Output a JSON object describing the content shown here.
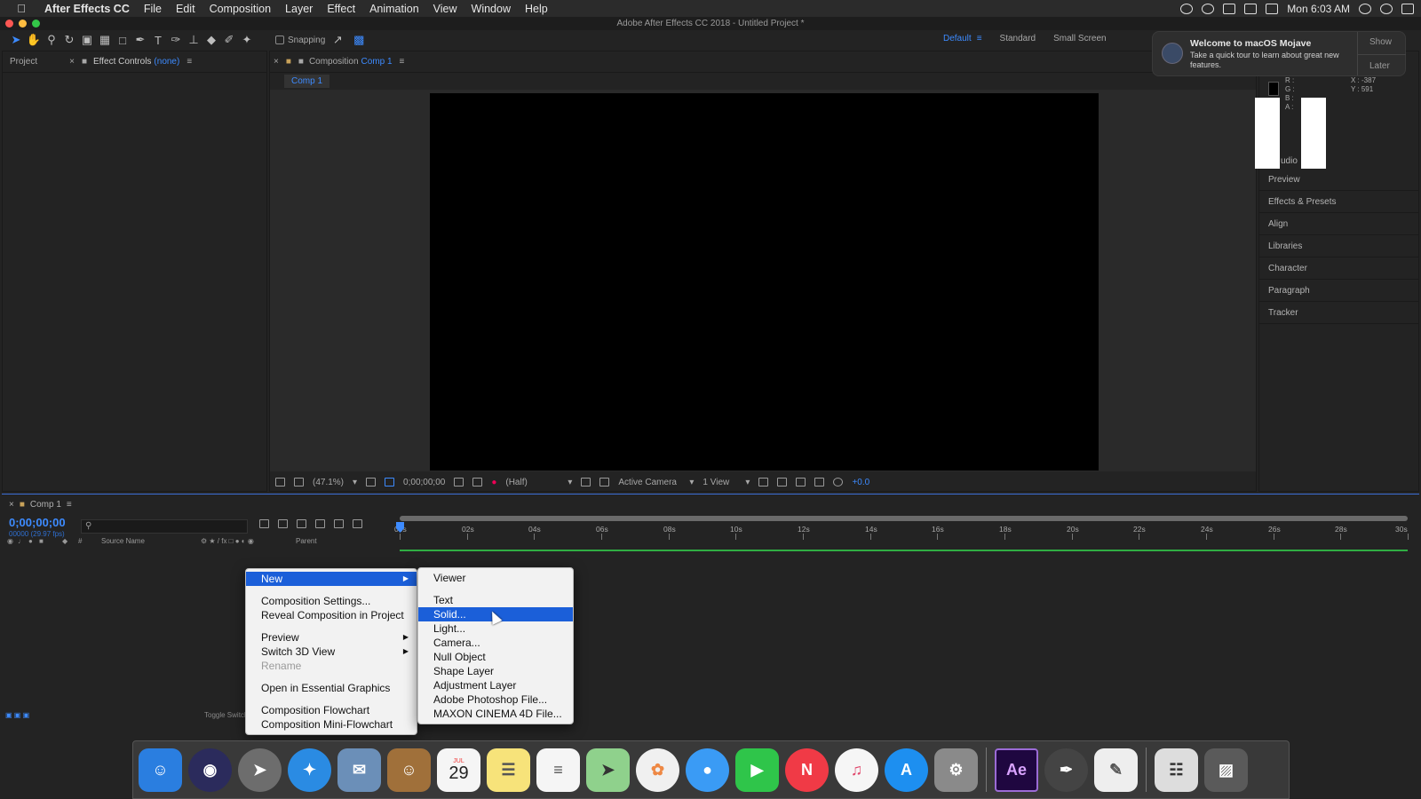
{
  "menubar": {
    "app_name": "After Effects CC",
    "items": [
      "File",
      "Edit",
      "Composition",
      "Layer",
      "Effect",
      "Animation",
      "View",
      "Window",
      "Help"
    ],
    "clock": "Mon 6:03 AM"
  },
  "window": {
    "title": "Adobe After Effects CC 2018 - Untitled Project *"
  },
  "toolbar": {
    "snapping_label": "Snapping"
  },
  "workspaces": {
    "items": [
      "Default",
      "Standard",
      "Small Screen"
    ],
    "active": "Default"
  },
  "notification": {
    "title": "Welcome to macOS Mojave",
    "body": "Take a quick tour to learn about great new features.",
    "show_label": "Show",
    "later_label": "Later"
  },
  "project_panel": {
    "project_tab": "Project",
    "effect_controls_tab": "Effect Controls",
    "effect_controls_target": "(none)"
  },
  "composition_panel": {
    "tab_prefix": "Composition",
    "tab_name": "Comp 1",
    "subtab": "Comp 1",
    "zoom": "(47.1%)",
    "timecode": "0;00;00;00",
    "resolution": "(Half)",
    "camera": "Active Camera",
    "views": "1 View",
    "exposure": "+0.0"
  },
  "info_panel": {
    "rgba_labels": "R :\nG :\nB :\nA :",
    "x_label": "X : -387",
    "y_label": "Y : 591",
    "audio_label": "udio"
  },
  "right_panels": [
    "Preview",
    "Effects & Presets",
    "Align",
    "Libraries",
    "Character",
    "Paragraph",
    "Tracker"
  ],
  "timeline": {
    "tab_name": "Comp 1",
    "timecode": "0;00;00;00",
    "fps": "00000 (29.97 fps)",
    "search_placeholder": "",
    "column_source_name": "Source Name",
    "column_parent": "Parent",
    "column_hash": "#",
    "ruler_labels": [
      "00s",
      "02s",
      "04s",
      "06s",
      "08s",
      "10s",
      "12s",
      "14s",
      "16s",
      "18s",
      "20s",
      "22s",
      "24s",
      "26s",
      "28s",
      "30s"
    ],
    "toggle_label": "Toggle Switches / Modes"
  },
  "context_menu": {
    "new": "New",
    "composition_settings": "Composition Settings...",
    "reveal": "Reveal Composition in Project",
    "preview": "Preview",
    "switch_3d": "Switch 3D View",
    "rename": "Rename",
    "open_essential": "Open in Essential Graphics",
    "flowchart": "Composition Flowchart",
    "mini_flowchart": "Composition Mini-Flowchart"
  },
  "new_submenu": {
    "viewer": "Viewer",
    "text": "Text",
    "solid": "Solid...",
    "light": "Light...",
    "camera": "Camera...",
    "null_object": "Null Object",
    "shape_layer": "Shape Layer",
    "adjustment_layer": "Adjustment Layer",
    "photoshop_file": "Adobe Photoshop File...",
    "cinema4d_file": "MAXON CINEMA 4D File..."
  },
  "dock": {
    "calendar_month": "JUL",
    "calendar_day": "29",
    "ae_label": "Ae"
  },
  "colors": {
    "accent_blue": "#3d8bff",
    "menu_highlight": "#1b5fd9",
    "work_area_green": "#2fae43"
  }
}
